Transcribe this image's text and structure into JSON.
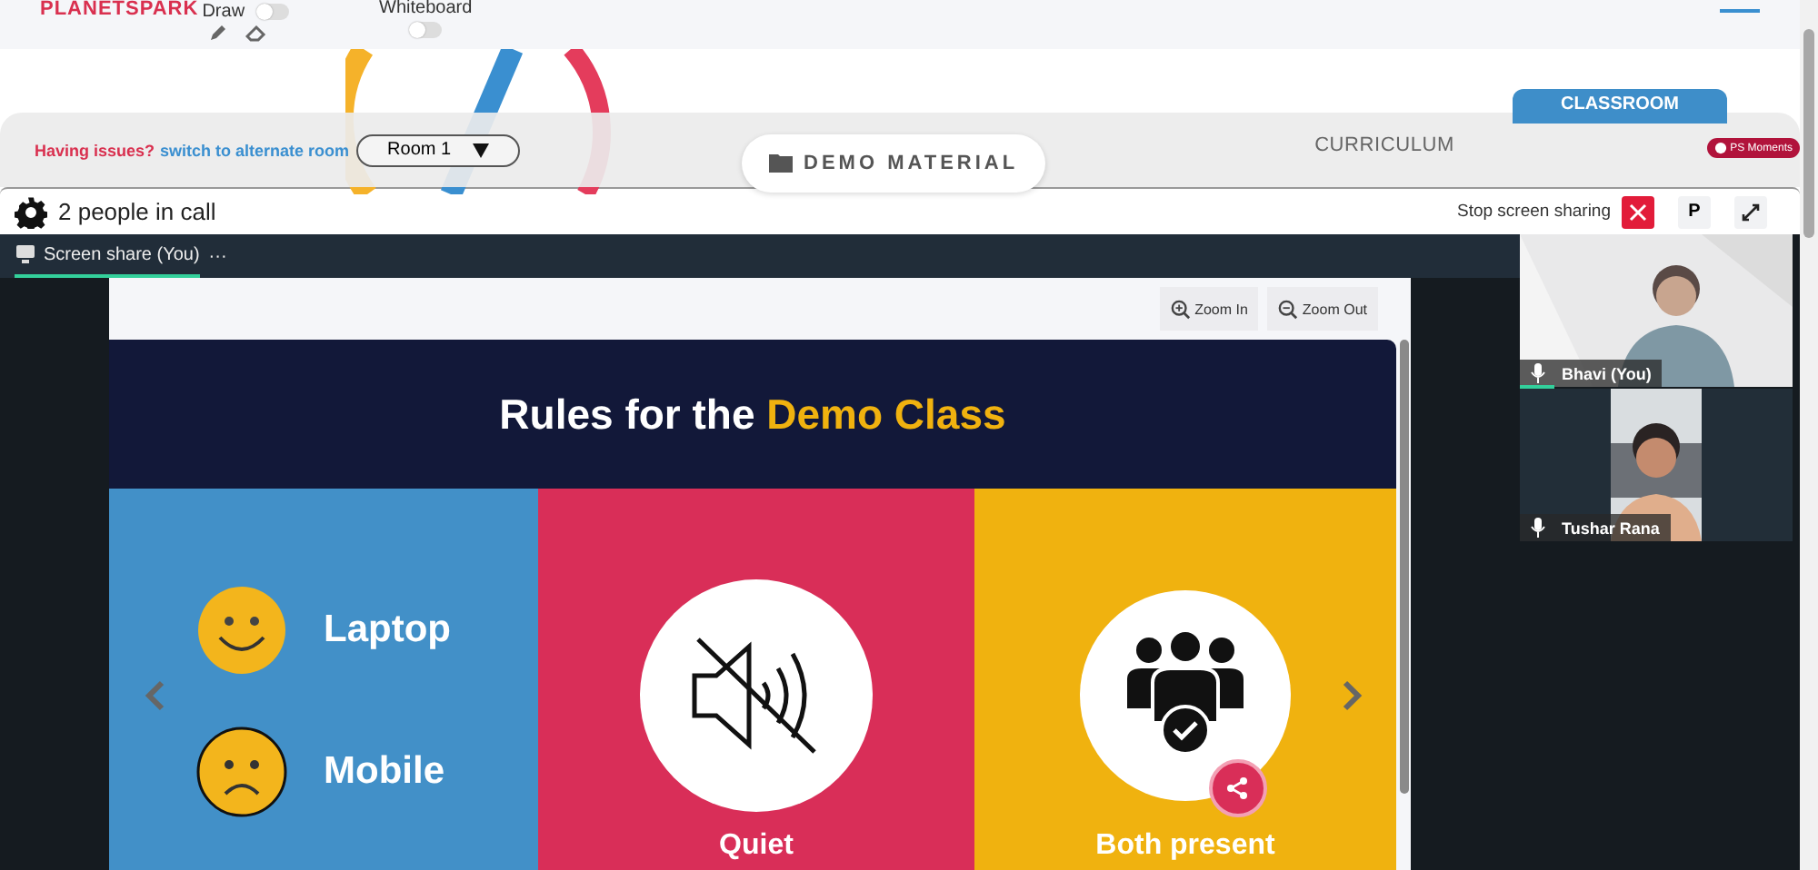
{
  "header": {
    "logo": "PLANETSPARK",
    "draw": {
      "label": "Draw",
      "on": false
    },
    "whiteboard": {
      "label": "Whiteboard",
      "on": false
    }
  },
  "classroom_tab": "CLASSROOM",
  "nav": {
    "issue_text": "Having issues?",
    "switch_link": "switch to alternate room",
    "room": "Room 1",
    "badge": "PS Moments",
    "tabs": [
      {
        "label": "DEMO MATERIAL",
        "selected": true
      },
      {
        "label": "CURRICULUM",
        "selected": false
      }
    ]
  },
  "call": {
    "title": "2 people in call",
    "stop_share": "Stop screen sharing",
    "p_button": "P"
  },
  "share_tab": {
    "label": "Screen share (You)",
    "more": "···",
    "selected": true
  },
  "zoom_buttons": [
    {
      "kind": "in",
      "label": "Zoom In"
    },
    {
      "kind": "out",
      "label": "Zoom Out"
    }
  ],
  "slide": {
    "title": "Rules for the",
    "highlight": "Demo Class",
    "panels": [
      {
        "kind": "devices",
        "color": "#4290c8",
        "items": [
          {
            "kind": "happy",
            "label": "Laptop"
          },
          {
            "kind": "sad",
            "label": "Mobile"
          }
        ]
      },
      {
        "kind": "muted",
        "color": "#d92e58",
        "caption": "Quiet"
      },
      {
        "kind": "group",
        "color": "#f0b20f",
        "caption": "Both present"
      }
    ]
  },
  "participants": [
    {
      "name": "Bhavi (You)",
      "speaking": true,
      "kind": "full"
    },
    {
      "name": "Tushar Rana",
      "speaking": false,
      "kind": "narrow"
    }
  ]
}
